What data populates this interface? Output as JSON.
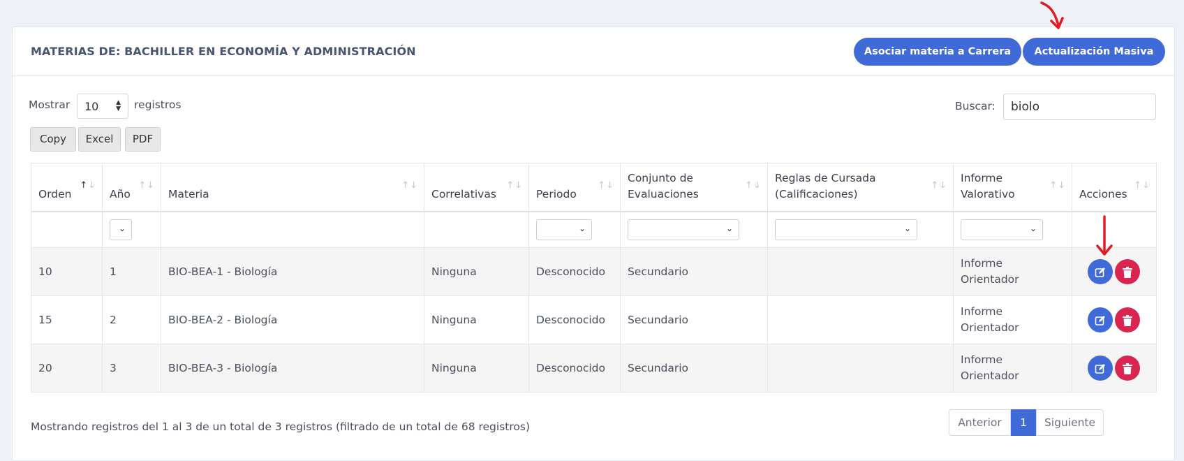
{
  "header": {
    "title": "MATERIAS DE: BACHILLER EN ECONOMÍA Y ADMINISTRACIÓN",
    "btn_associate": "Asociar materia a Carrera",
    "btn_bulk_update": "Actualización Masiva"
  },
  "length": {
    "show_label": "Mostrar",
    "value": "10",
    "records_label": "registros"
  },
  "search": {
    "label": "Buscar:",
    "value": "biolo"
  },
  "export": {
    "copy": "Copy",
    "excel": "Excel",
    "pdf": "PDF"
  },
  "table": {
    "headers": {
      "orden": "Orden",
      "anio": "Año",
      "materia": "Materia",
      "correlativas": "Correlativas",
      "periodo": "Periodo",
      "conjunto": "Conjunto de Evaluaciones",
      "reglas": "Reglas de Cursada (Calificaciones)",
      "informe": "Informe Valorativo",
      "acciones": "Acciones"
    },
    "rows": [
      {
        "orden": "10",
        "anio": "1",
        "materia": "BIO-BEA-1 - Biología",
        "correlativas": "Ninguna",
        "periodo": "Desconocido",
        "conjunto": "Secundario",
        "reglas": "",
        "informe": "Informe Orientador"
      },
      {
        "orden": "15",
        "anio": "2",
        "materia": "BIO-BEA-2 - Biología",
        "correlativas": "Ninguna",
        "periodo": "Desconocido",
        "conjunto": "Secundario",
        "reglas": "",
        "informe": "Informe Orientador"
      },
      {
        "orden": "20",
        "anio": "3",
        "materia": "BIO-BEA-3 - Biología",
        "correlativas": "Ninguna",
        "periodo": "Desconocido",
        "conjunto": "Secundario",
        "reglas": "",
        "informe": "Informe Orientador"
      }
    ]
  },
  "footer": {
    "info": "Mostrando registros del 1 al 3 de un total de 3 registros (filtrado de un total de 68 registros)",
    "prev": "Anterior",
    "page": "1",
    "next": "Siguiente"
  },
  "colors": {
    "primary": "#3f6ad8",
    "danger": "#d92550",
    "annotation": "#e01b24"
  },
  "icons": {
    "edit": "edit-icon",
    "delete": "trash-icon",
    "annotation": "red-arrow-icon"
  }
}
